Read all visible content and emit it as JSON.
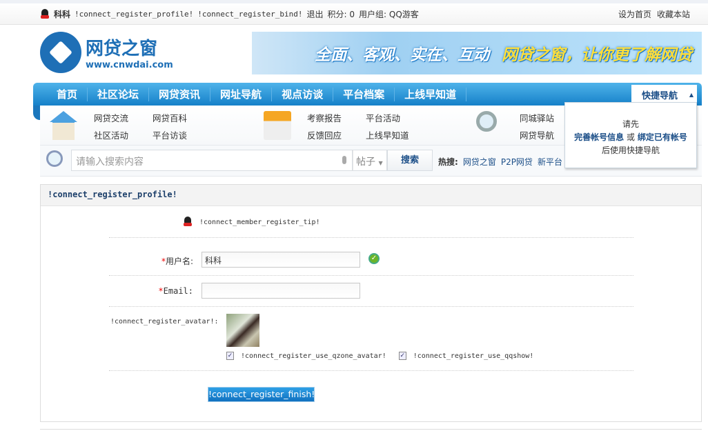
{
  "topbar": {
    "username": "科科",
    "profile_link": "!connect_register_profile!",
    "bind_link": "!connect_register_bind!",
    "logout": "退出",
    "credits": "积分: 0",
    "usergroup": "用户组: QQ游客",
    "set_home": "设为首页",
    "bookmark": "收藏本站"
  },
  "logo": {
    "name": "网贷之窗",
    "url_text": "www.cnwdai.com"
  },
  "banner": {
    "text1": "全面、客观、实在、互动",
    "text2": "网贷之窗，让你更了解网贷"
  },
  "nav": {
    "items": [
      "首页",
      "社区论坛",
      "网贷资讯",
      "网址导航",
      "视点访谈",
      "平台档案",
      "上线早知道"
    ],
    "quick": "快捷导航"
  },
  "subnav": {
    "groups": [
      [
        "网贷交流",
        "网贷百科",
        "社区活动",
        "平台访谈"
      ],
      [
        "考察报告",
        "平台活动",
        "反馈回应",
        "上线早知道"
      ],
      [
        "同城驿站",
        "网贷导航"
      ]
    ]
  },
  "search": {
    "placeholder": "请输入搜索内容",
    "type": "帖子",
    "button": "搜索",
    "hot_label": "热搜:",
    "hot": [
      "网贷之窗",
      "P2P网贷",
      "新平台"
    ]
  },
  "quick_drop": {
    "line1": "请先",
    "link1": "完善帐号信息",
    "or": "或",
    "link2": "绑定已有帐号",
    "line3": "后使用快捷导航"
  },
  "form": {
    "title": "!connect_register_profile!",
    "tip": "!connect_member_register_tip!",
    "username_label": "用户名:",
    "username_value": "科科",
    "email_label": "Email:",
    "email_value": "",
    "avatar_label": "!connect_register_avatar!:",
    "use_qzone": "!connect_register_use_qzone_avatar!",
    "use_qqshow": "!connect_register_use_qqshow!",
    "qzone_checked": true,
    "qqshow_checked": true,
    "finish": "!connect_register_finish!",
    "required": "*"
  }
}
